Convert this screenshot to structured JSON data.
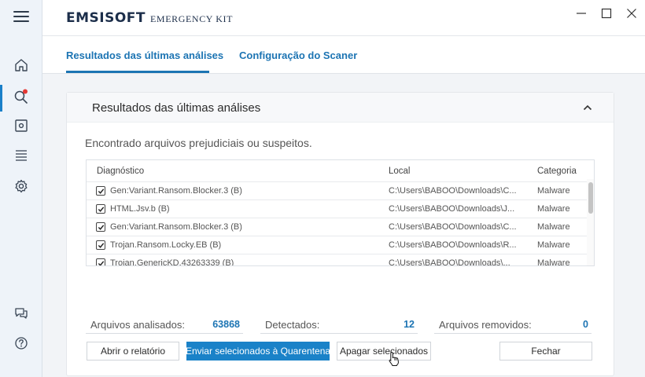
{
  "app": {
    "brand": "EMSISOFT",
    "product": "EMERGENCY KIT"
  },
  "sidebar": {
    "items": [
      {
        "name": "menu",
        "icon": "hamburger-menu-icon"
      },
      {
        "name": "home",
        "icon": "home-icon"
      },
      {
        "name": "scan",
        "icon": "search-icon",
        "active": true,
        "notification_dot": true
      },
      {
        "name": "quarantine",
        "icon": "quarantine-box-icon"
      },
      {
        "name": "logs",
        "icon": "list-icon"
      },
      {
        "name": "settings",
        "icon": "gear-icon"
      },
      {
        "name": "support",
        "icon": "chat-icon"
      },
      {
        "name": "help",
        "icon": "help-icon"
      }
    ]
  },
  "tabs": [
    {
      "label": "Resultados das últimas análises",
      "active": true
    },
    {
      "label": "Configuração do Scaner",
      "active": false
    }
  ],
  "panel": {
    "title": "Resultados das últimas análises",
    "subtitle": "Encontrado arquivos prejudiciais ou suspeitos."
  },
  "table": {
    "columns": [
      "Diagnóstico",
      "Local",
      "Categoria"
    ],
    "rows": [
      {
        "checked": true,
        "diagnostic": "Gen:Variant.Ransom.Blocker.3 (B)",
        "location": "C:\\Users\\BABOO\\Downloads\\C...",
        "category": "Malware"
      },
      {
        "checked": true,
        "diagnostic": "HTML.Jsv.b (B)",
        "location": "C:\\Users\\BABOO\\Downloads\\J...",
        "category": "Malware"
      },
      {
        "checked": true,
        "diagnostic": "Gen:Variant.Ransom.Blocker.3 (B)",
        "location": "C:\\Users\\BABOO\\Downloads\\C...",
        "category": "Malware"
      },
      {
        "checked": true,
        "diagnostic": "Trojan.Ransom.Locky.EB (B)",
        "location": "C:\\Users\\BABOO\\Downloads\\R...",
        "category": "Malware"
      },
      {
        "checked": true,
        "diagnostic": "Trojan.GenericKD.43263339 (B)",
        "location": "C:\\Users\\BABOO\\Downloads\\...",
        "category": "Malware"
      }
    ]
  },
  "stats": {
    "analyzed_label": "Arquivos analisados:",
    "analyzed_value": "63868",
    "detected_label": "Detectados:",
    "detected_value": "12",
    "removed_label": "Arquivos removidos:",
    "removed_value": "0"
  },
  "buttons": {
    "open_report": "Abrir o relatório",
    "quarantine": "Enviar selecionados à Quarentena",
    "delete": "Apagar selecionados",
    "close": "Fechar"
  },
  "colors": {
    "accent": "#1a82c8",
    "tab_text": "#1c74b3",
    "notification": "#e53935",
    "sidebar_bg": "#eef3f9"
  }
}
